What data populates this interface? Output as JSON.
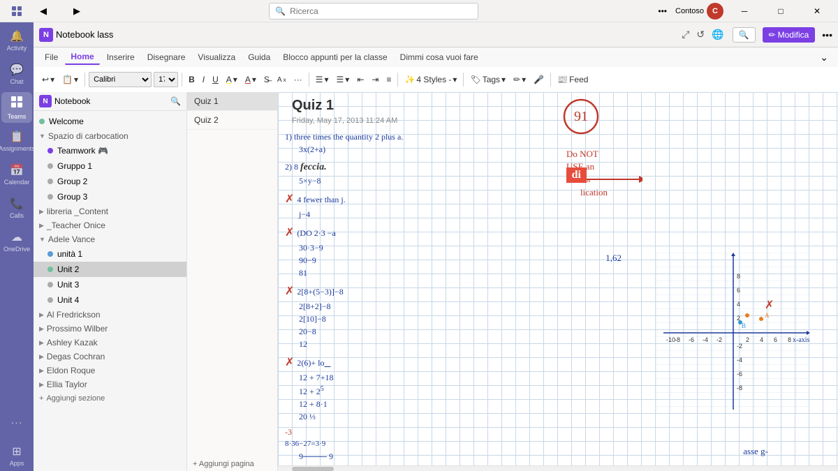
{
  "titlebar": {
    "back_icon": "◀",
    "forward_icon": "▶",
    "search_placeholder": "Ricerca",
    "more_icon": "•••",
    "user_name": "Contoso",
    "min_icon": "─",
    "max_icon": "□",
    "close_icon": "✕"
  },
  "nav_rail": {
    "items": [
      {
        "id": "activity",
        "icon": "🔔",
        "label": "Activity"
      },
      {
        "id": "chat",
        "icon": "💬",
        "label": "Chat"
      },
      {
        "id": "teams",
        "icon": "👥",
        "label": "Teams",
        "active": true
      },
      {
        "id": "assignments",
        "icon": "📋",
        "label": "Assignments"
      },
      {
        "id": "calendar",
        "icon": "📅",
        "label": "Calendar"
      },
      {
        "id": "calls",
        "icon": "📞",
        "label": "Calls"
      },
      {
        "id": "onedrive",
        "icon": "☁",
        "label": "OneDrive"
      }
    ],
    "bottom_items": [
      {
        "id": "more",
        "icon": "•••",
        "label": ""
      },
      {
        "id": "apps",
        "icon": "⊞",
        "label": "Apps"
      }
    ]
  },
  "app_tabs": [
    {
      "id": "file",
      "label": "File"
    },
    {
      "id": "home",
      "label": "Home",
      "active": true
    },
    {
      "id": "insert",
      "label": "Inserire"
    },
    {
      "id": "draw",
      "label": "Disegnare"
    },
    {
      "id": "view",
      "label": "Visualizza"
    },
    {
      "id": "help",
      "label": "Guida"
    },
    {
      "id": "classnotebook",
      "label": "Blocco appunti per la classe"
    },
    {
      "id": "tellme",
      "label": "Dimmi cosa vuoi fare"
    }
  ],
  "ribbon": {
    "undo_icon": "↩",
    "clipboard_icon": "📋",
    "font_family": "Calibri",
    "font_size": "17",
    "bold": "B",
    "italic": "I",
    "underline": "U",
    "highlight_icon": "A",
    "color_icon": "A",
    "styles_label": "Styles",
    "styles_count": "4 Styles -",
    "tags_label": "Tags",
    "mic_icon": "🎤",
    "feed_label": "Feed",
    "expand_icon": "⌄"
  },
  "onenote_bar": {
    "search_icon": "🔍",
    "edit_label": "Modifica",
    "more_icon": "•••",
    "restore_icon": "⤢",
    "refresh_icon": "↺",
    "globe_icon": "🌐"
  },
  "notebook": {
    "icon": "N",
    "name": "Notebook lass"
  },
  "sidebar": {
    "search_icon": "🔍",
    "sections": [
      {
        "id": "welcome",
        "label": "Welcome",
        "color": "#70c0a0",
        "indent": 0
      },
      {
        "id": "spazio",
        "label": "Spazio di carbocation",
        "indent": 0,
        "expanded": true,
        "children": [
          {
            "id": "teamwork",
            "label": "Teamwork 🎮",
            "color": "#7b3fe4",
            "indent": 1
          },
          {
            "id": "gruppo1",
            "label": "Gruppo 1",
            "color": "#aaa",
            "indent": 1
          },
          {
            "id": "group2",
            "label": "Group 2",
            "color": "#aaa",
            "indent": 1
          },
          {
            "id": "group3",
            "label": "Group 3",
            "color": "#aaa",
            "indent": 1
          }
        ]
      },
      {
        "id": "libreria",
        "label": "libreria _Content",
        "indent": 0,
        "collapsed": true
      },
      {
        "id": "teacher",
        "label": "_Teacher Onice",
        "indent": 0,
        "collapsed": true
      },
      {
        "id": "adele",
        "label": "Adele Vance",
        "indent": 0,
        "expanded": true,
        "children": [
          {
            "id": "unita1",
            "label": "unità 1",
            "color": "#5b9bd5",
            "indent": 1
          },
          {
            "id": "unit2",
            "label": "Unit 2",
            "color": "#70c0a0",
            "indent": 1,
            "active": true
          },
          {
            "id": "unit3",
            "label": "Unit 3",
            "color": "#aaa",
            "indent": 1
          },
          {
            "id": "unit4",
            "label": "Unit 4",
            "color": "#aaa",
            "indent": 1
          }
        ]
      },
      {
        "id": "alfredrickson",
        "label": "Al Fredrickson",
        "indent": 0,
        "collapsed": true
      },
      {
        "id": "prossimowilber",
        "label": "Prossimo Wilber",
        "indent": 0,
        "collapsed": true
      },
      {
        "id": "ashleykazak",
        "label": "Ashley Kazak",
        "indent": 0,
        "collapsed": true
      },
      {
        "id": "degascochran",
        "label": "Degas Cochran",
        "indent": 0,
        "collapsed": true
      },
      {
        "id": "eldonroque",
        "label": "Eldon Roque",
        "indent": 0,
        "collapsed": true
      },
      {
        "id": "elliataylor",
        "label": "Ellia Taylor",
        "indent": 0,
        "collapsed": true
      }
    ],
    "add_section_label": "Aggiungi sezione"
  },
  "pages": [
    {
      "id": "quiz1",
      "label": "Quiz 1",
      "active": true
    },
    {
      "id": "quiz2",
      "label": "Quiz 2"
    }
  ],
  "add_page_label": "Aggiungi pagina",
  "page": {
    "title": "Quiz 1",
    "date": "Friday, May 17, 2013   11:24 AM",
    "score": "91",
    "content_lines": [
      "1) three times the quantity 2 plus a.",
      "   3x(2+a)",
      "2) 8 feccia.",
      "   5×y−8",
      "3) 4 fewer than j.",
      "   j−4",
      "4) (DO 2·3 −a",
      "   30·3−9",
      "   90−9",
      "   81",
      "5) 2[8+(5−3)]−8",
      "   2[8+2]−8",
      "   2[10]−8",
      "   20−8",
      "   12",
      "6) 2(6)+ lo_",
      "   12 + 7+18",
      "   12 + 25",
      "   12 + 8·1",
      "   20 1/3",
      "-3",
      "   8·36−27=3·9",
      "   9----- 9"
    ],
    "annotation_text": "Do NOT USE an X for lication",
    "highlight_text": "di",
    "graph_label": "asse g-",
    "graph_value": "1,62"
  }
}
